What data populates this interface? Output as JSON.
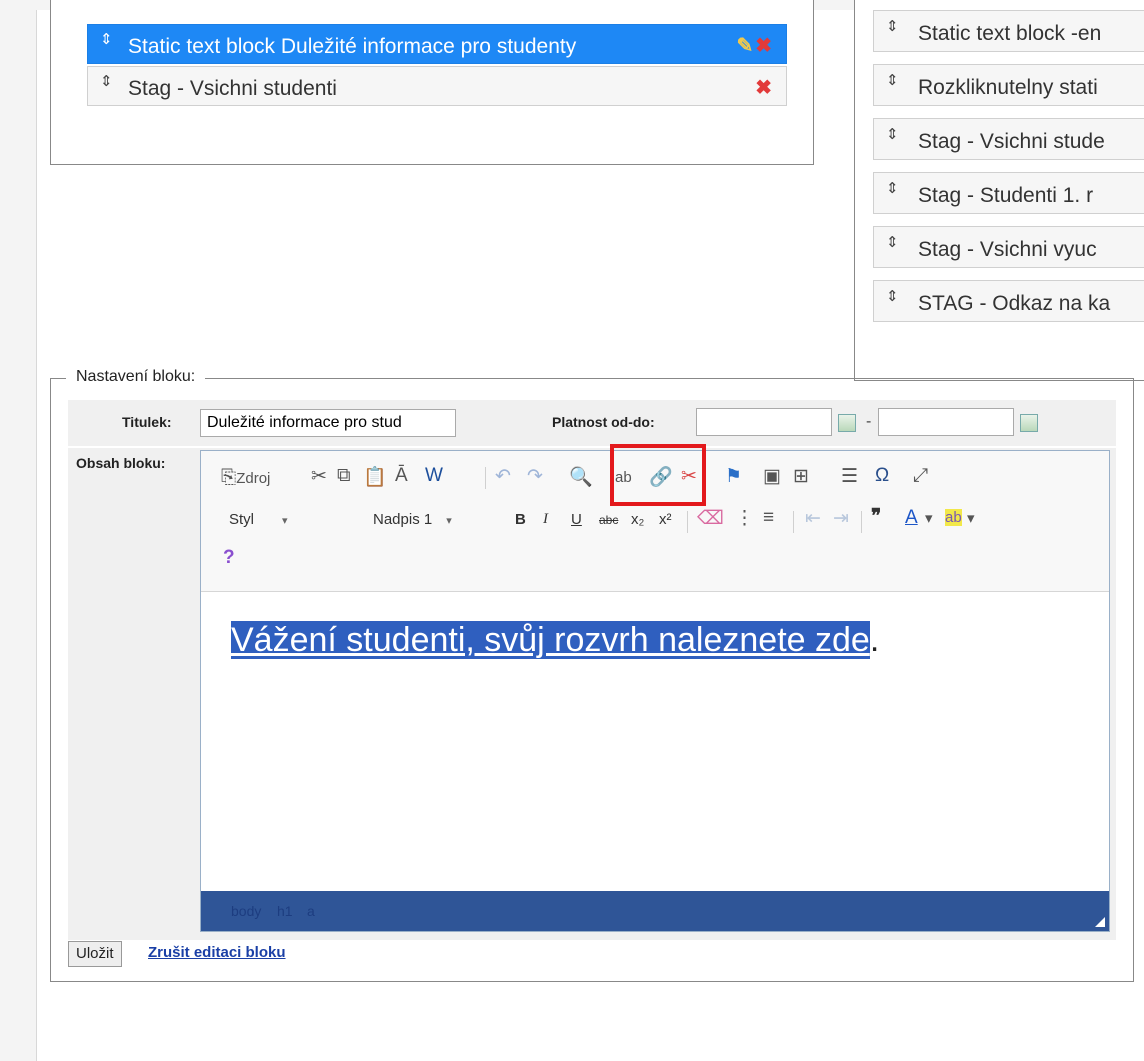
{
  "left_list": {
    "items": [
      {
        "drag": "⇕",
        "label": "Static text block Duležité informace pro studenty",
        "edit_icon": "✎",
        "delete_icon": "✖"
      },
      {
        "drag": "⇕",
        "label": "Stag - Vsichni studenti",
        "delete_icon": "✖"
      }
    ]
  },
  "right_list": {
    "items": [
      {
        "drag": "⇕",
        "label": "Static text block -en"
      },
      {
        "drag": "⇕",
        "label": "Rozkliknutelny stati"
      },
      {
        "drag": "⇕",
        "label": "Stag - Vsichni stude"
      },
      {
        "drag": "⇕",
        "label": "Stag - Studenti 1. r"
      },
      {
        "drag": "⇕",
        "label": "Stag - Vsichni vyuc"
      },
      {
        "drag": "⇕",
        "label": "STAG - Odkaz na ka"
      }
    ]
  },
  "settings": {
    "legend": "Nastavení bloku:",
    "title_label": "Titulek:",
    "title_value": "Duležité informace pro stud",
    "validity_label": "Platnost od-do:",
    "validity_from": "",
    "validity_to": "",
    "dash": "-",
    "content_label": "Obsah bloku:"
  },
  "toolbar": {
    "source_label": "Zdroj",
    "style_combo": "Styl",
    "format_combo": "Nadpis 1",
    "help": "?",
    "icons": {
      "source": "⎘",
      "cut": "✂",
      "copy": "⧉",
      "paste": "📋",
      "paste_text": "Ā",
      "paste_word": "W",
      "undo": "↶",
      "redo": "↷",
      "find": "🔍",
      "replace": "ab",
      "link": "🔗",
      "unlink": "✂",
      "anchor": "⚑",
      "image": "▣",
      "table": "⊞",
      "hr": "☰",
      "omega": "Ω",
      "maximize": "⤢",
      "bold": "B",
      "italic": "I",
      "underline": "U",
      "strike": "abc",
      "subscript": "x₂",
      "superscript": "x²",
      "remove_format": "⌫",
      "ordered_list": "⋮",
      "bullet_list": "≡",
      "outdent": "⇤",
      "indent": "⇥",
      "blockquote": "❞",
      "text_color": "A",
      "bg_color": "ab"
    }
  },
  "content": {
    "link_text": "Vážení studenti, svůj rozvrh naleznete zde",
    "trailing": "."
  },
  "statusbar": {
    "path": [
      "body",
      "h1",
      "a"
    ]
  },
  "actions": {
    "save": "Uložit",
    "cancel": "Zrušit editaci bloku"
  },
  "colors": {
    "selected": "#1e88f5",
    "highlight": "#e3191c",
    "statusbar": "#2f5597"
  }
}
